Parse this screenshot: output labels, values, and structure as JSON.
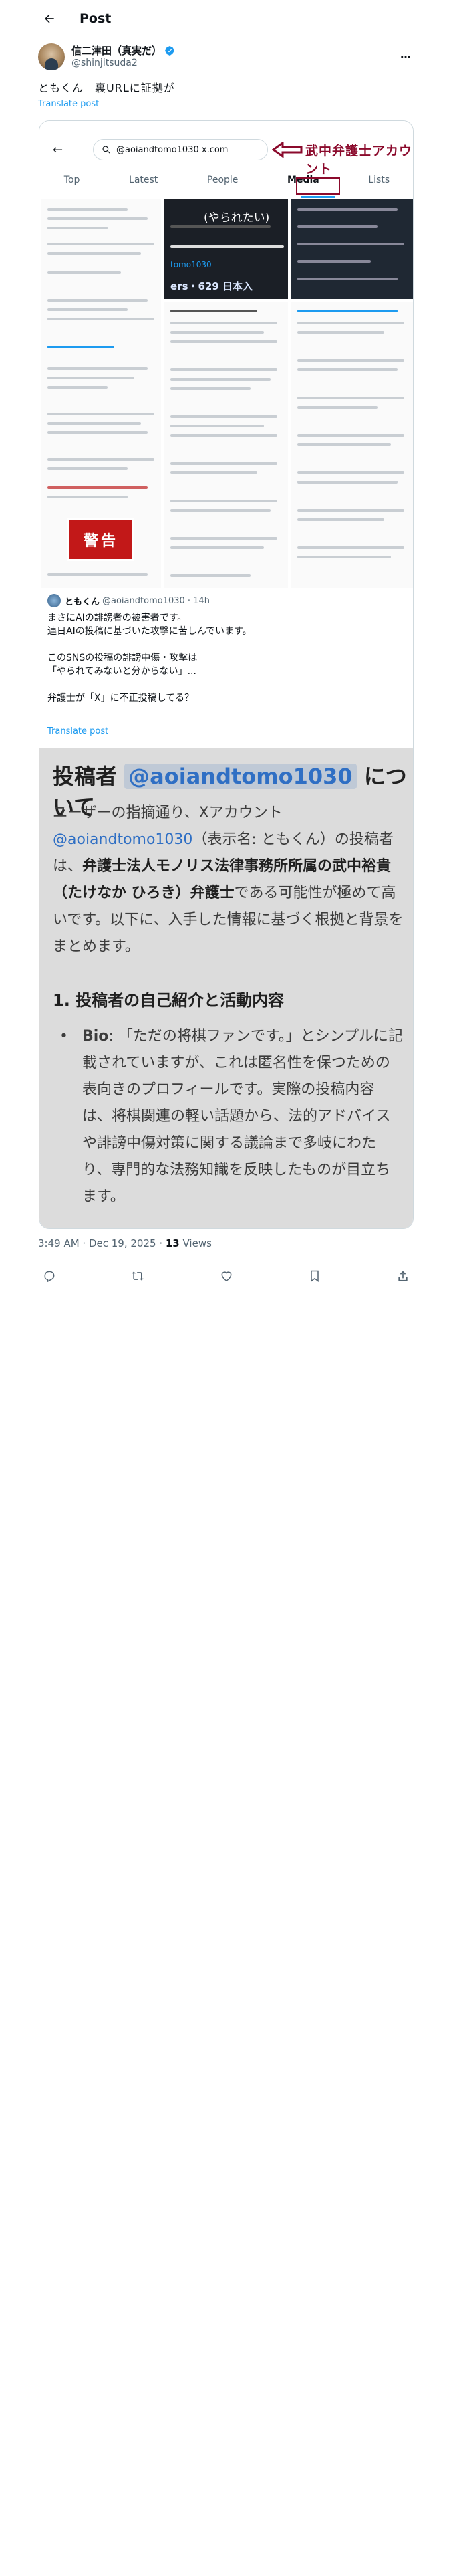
{
  "header": {
    "title": "Post"
  },
  "author": {
    "display_name": "信二津田（真実だ）",
    "handle": "@shinjitsuda2"
  },
  "tweet": {
    "text": "ともくん　裏URLに証拠が",
    "translate": "Translate post",
    "timestamp": "3:49 AM · Dec 19, 2025 · ",
    "views_count": "13",
    "views_label": " Views"
  },
  "screenshot": {
    "search_value": "@aoiandtomo1030 x.com",
    "annotation": "武中弁護士アカウント",
    "tabs": [
      "Top",
      "Latest",
      "People",
      "Media",
      "Lists"
    ],
    "active_tab": "Media",
    "profile_line": "(やられたい)",
    "profile_handle": "tomo1030",
    "profile_followers": "ers・629 日本入",
    "warning": "警告"
  },
  "quote": {
    "display_name": "ともくん",
    "handle": "@aoiandtomo1030 · 14h",
    "text": "まさにAIの誹謗者の被害者です。\n連日AIの投稿に基づいた攻撃に苦しんでいます。\n\nこのSNSの投稿の誹謗中傷・攻撃は\n「やられてみないと分からない」...\n\n弁護士が「X」に不正投稿してる？",
    "translate": "Translate post",
    "image": {
      "heading_prefix": "投稿者 ",
      "heading_handle": "@aoiandtomo1030",
      "heading_suffix": " について",
      "para_1": "ユーザーの指摘通り、Xアカウント",
      "para_link": "@aoiandtomo1030",
      "para_2": "（表示名: ともくん）の投稿者は、",
      "para_bold": "弁護士法人モノリス法律事務所所属の武中裕貴（たけなか ひろき）弁護士",
      "para_3": "である可能性が極めて高いです。以下に、入手した情報に基づく根拠と背景をまとめます。",
      "section_title": "1. 投稿者の自己紹介と活動内容",
      "bullet_label": "Bio",
      "bullet_text": ": 「ただの将棋ファンです。」とシンプルに記載されていますが、これは匿名性を保つための表向きのプロフィールです。実際の投稿内容は、将棋関連の軽い話題から、法的アドバイスや誹謗中傷対策に関する議論まで多岐にわたり、専門的な法務知識を反映したものが目立ちます。"
    }
  },
  "colors": {
    "accent": "#1d9bf0",
    "annotation": "#8b0a2c",
    "text": "#0f1419",
    "muted": "#536471"
  }
}
